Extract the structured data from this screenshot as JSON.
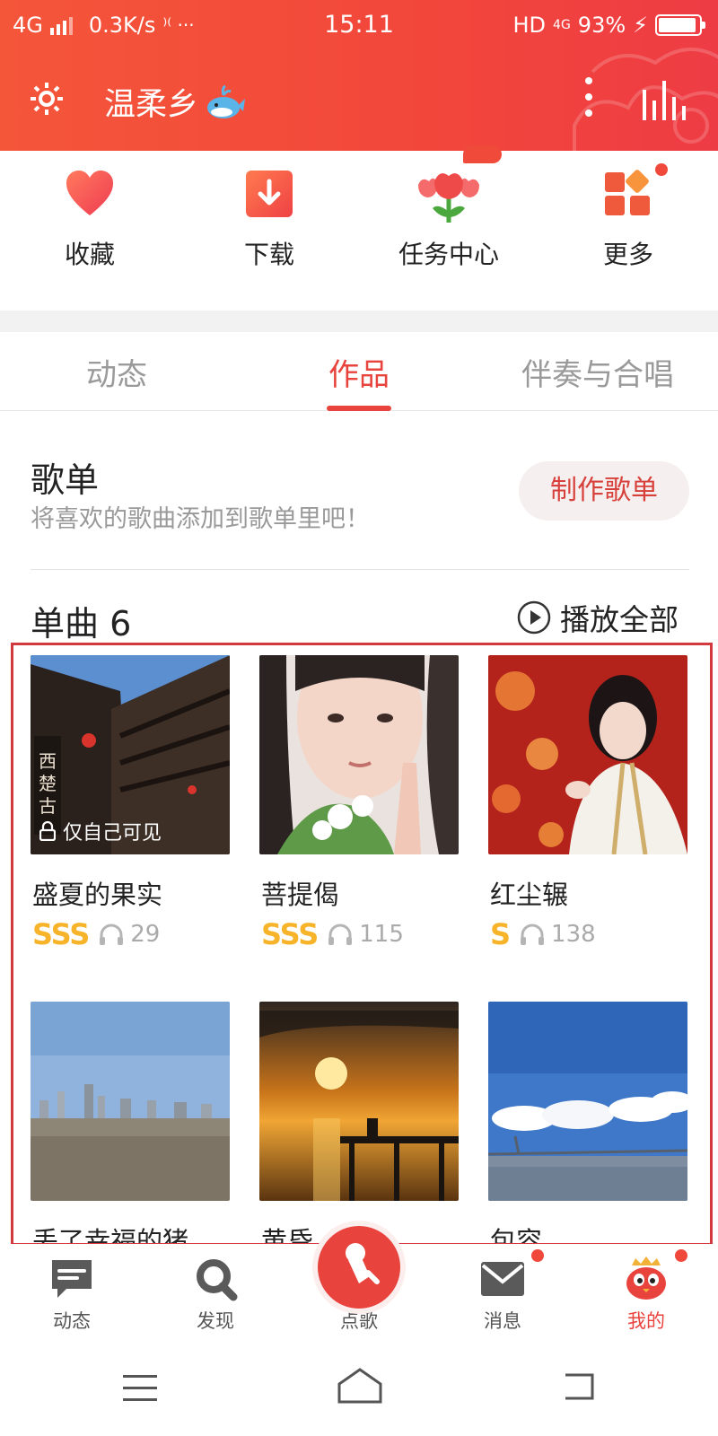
{
  "status_bar": {
    "network": "4G",
    "speed": "0.3K/s",
    "extra": "⁾⁽ ···",
    "time": "15:11",
    "hd": "HD",
    "net_right": "4G",
    "battery": "93%",
    "battery_level": 0.93
  },
  "header": {
    "title": "温柔乡",
    "accent_color": "#f2463b"
  },
  "quick_actions": [
    {
      "label": "收藏",
      "icon": "heart-icon"
    },
    {
      "label": "下载",
      "icon": "download-icon"
    },
    {
      "label": "任务中心",
      "icon": "tulip-icon"
    },
    {
      "label": "更多",
      "icon": "grid-icon"
    }
  ],
  "tabs": [
    {
      "label": "动态",
      "active": false
    },
    {
      "label": "作品",
      "active": true
    },
    {
      "label": "伴奏与合唱",
      "active": false
    }
  ],
  "playlist": {
    "title": "歌单",
    "subtitle": "将喜欢的歌曲添加到歌单里吧！",
    "button": "制作歌单"
  },
  "singles": {
    "title": "单曲 6",
    "play_all": "播放全部",
    "items": [
      {
        "title": "盛夏的果实",
        "grade": "SSS",
        "listens": "29",
        "private_label": "仅自己可见"
      },
      {
        "title": "菩提偈",
        "grade": "SSS",
        "listens": "115"
      },
      {
        "title": "红尘辗",
        "grade": "S",
        "listens": "138"
      },
      {
        "title": "丢了幸福的猪",
        "grade": "",
        "listens": ""
      },
      {
        "title": "黄昏",
        "grade": "",
        "listens": ""
      },
      {
        "title": "包容",
        "grade": "",
        "listens": ""
      }
    ]
  },
  "bottom_nav": [
    {
      "label": "动态",
      "icon": "chat-icon",
      "active": false
    },
    {
      "label": "发现",
      "icon": "search-icon",
      "active": false
    },
    {
      "label": "点歌",
      "icon": "mic-icon",
      "active": false
    },
    {
      "label": "消息",
      "icon": "mail-icon",
      "active": false
    },
    {
      "label": "我的",
      "icon": "avatar-icon",
      "active": true
    }
  ]
}
